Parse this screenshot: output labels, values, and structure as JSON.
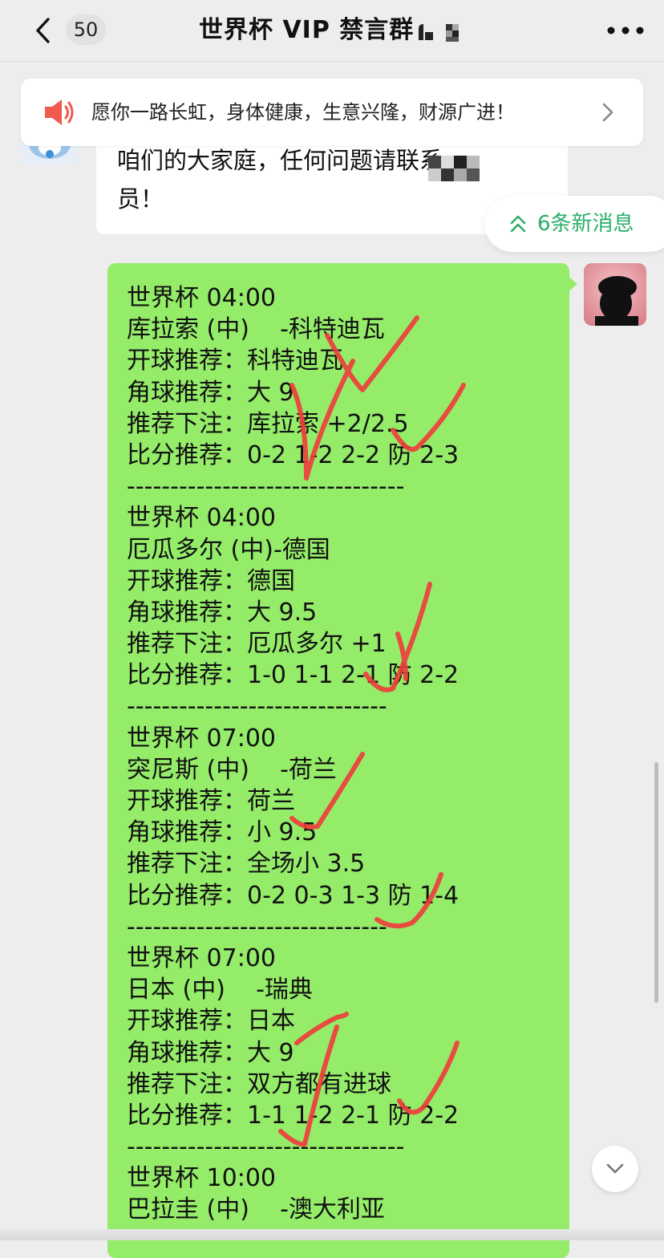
{
  "header": {
    "back_label": "<",
    "unread_count": "50",
    "title": "世界杯 VIP 禁言群"
  },
  "announcement": {
    "text": "愿你一路长虹，身体健康，生意兴隆，财源广进！"
  },
  "incoming_message": {
    "lines": [
      "咱们的大家庭，任何问题请联系",
      "员！"
    ]
  },
  "new_messages": {
    "label": "6条新消息"
  },
  "outgoing_message": {
    "lines": [
      "世界杯 04:00",
      "库拉索 (中)    -科特迪瓦",
      "开球推荐：科特迪瓦",
      "角球推荐：大 9",
      "推荐下注：库拉索 +2/2.5",
      "比分推荐：0-2 1-2 2-2 防 2-3",
      "--------------------------------",
      "世界杯 04:00",
      "厄瓜多尔 (中)-德国",
      "开球推荐：德国",
      "角球推荐：大 9.5",
      "推荐下注：厄瓜多尔 +1",
      "比分推荐：1-0 1-1 2-1 防 2-2",
      "------------------------------",
      "世界杯 07:00",
      "突尼斯 (中)    -荷兰",
      "开球推荐：荷兰",
      "角球推荐：小 9.5",
      "推荐下注：全场小 3.5",
      "比分推荐：0-2 0-3 1-3 防 1-4",
      "------------------------------",
      "世界杯 07:00",
      "日本 (中)    -瑞典",
      "开球推荐：日本",
      "角球推荐：大 9",
      "推荐下注：双方都有进球",
      "比分推荐：1-1 1-2 2-1 防 2-2",
      "--------------------------------",
      "世界杯 10:00",
      "巴拉圭 (中)    -澳大利亚"
    ]
  },
  "icons": {
    "back": "chevron-left-icon",
    "more": "more-dots-icon",
    "speaker": "speaker-icon",
    "announce_arrow": "chevron-right-icon",
    "new_messages": "double-chevron-up-icon",
    "scroll_down": "chevron-down-icon"
  },
  "colors": {
    "background": "#ededed",
    "outgoing_bubble": "#95ec69",
    "incoming_bubble": "#ffffff",
    "speaker": "#f05a4f",
    "new_messages_text": "#2aae67",
    "check_marks": "#ef3b3b"
  }
}
